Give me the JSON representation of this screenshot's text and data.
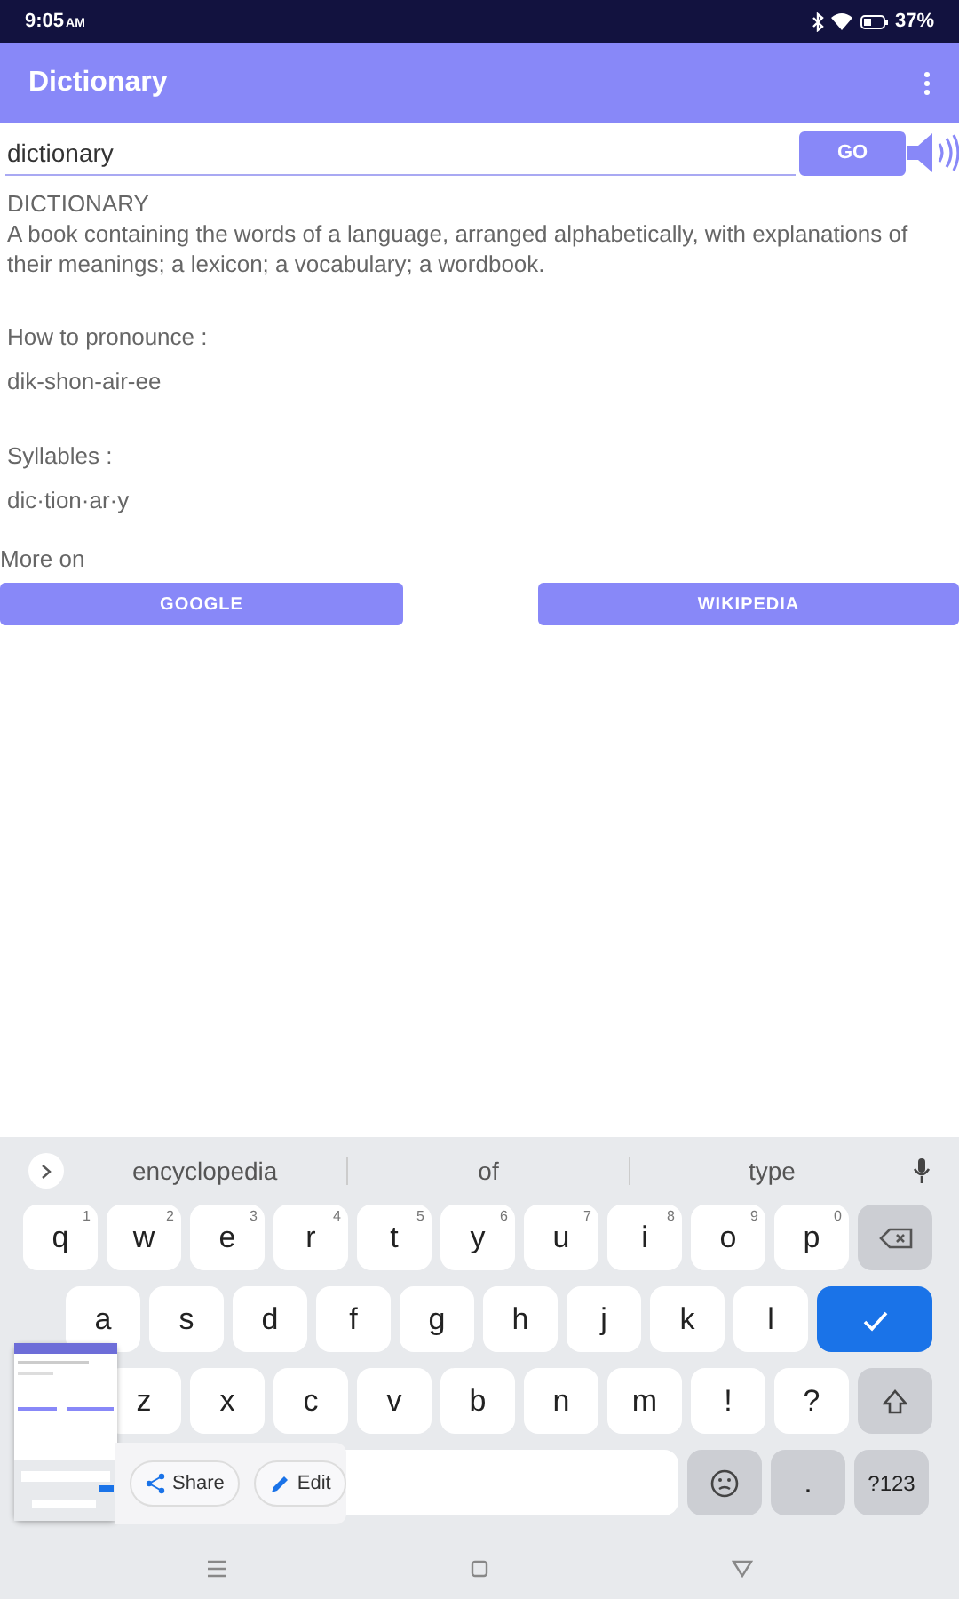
{
  "status_bar": {
    "time": "9:05",
    "meridiem": "AM",
    "battery": "37%"
  },
  "app_bar": {
    "title": "Dictionary"
  },
  "search": {
    "value": "dictionary",
    "button": "GO"
  },
  "entry": {
    "headword": "DICTIONARY",
    "definition": "A book containing the words of a language, arranged alphabetically, with explanations of their meanings; a lexicon; a vocabulary; a wordbook.",
    "pronounce_label": "How to pronounce :",
    "pronunciation": "dik-shon-air-ee",
    "syllables_label": "Syllables :",
    "syllables": "dic·tion·ar·y"
  },
  "more_on": {
    "label": "More on",
    "buttons": [
      "GOOGLE",
      "WIKIPEDIA"
    ]
  },
  "keyboard": {
    "suggestions": [
      "encyclopedia",
      "of",
      "type"
    ],
    "rows": [
      [
        {
          "kind": "char",
          "label": "q",
          "hint": "1"
        },
        {
          "kind": "char",
          "label": "w",
          "hint": "2"
        },
        {
          "kind": "char",
          "label": "e",
          "hint": "3"
        },
        {
          "kind": "char",
          "label": "r",
          "hint": "4"
        },
        {
          "kind": "char",
          "label": "t",
          "hint": "5"
        },
        {
          "kind": "char",
          "label": "y",
          "hint": "6"
        },
        {
          "kind": "char",
          "label": "u",
          "hint": "7"
        },
        {
          "kind": "char",
          "label": "i",
          "hint": "8"
        },
        {
          "kind": "char",
          "label": "o",
          "hint": "9"
        },
        {
          "kind": "char",
          "label": "p",
          "hint": "0"
        },
        {
          "kind": "backspace"
        }
      ],
      [
        {
          "kind": "char",
          "label": "a"
        },
        {
          "kind": "char",
          "label": "s"
        },
        {
          "kind": "char",
          "label": "d"
        },
        {
          "kind": "char",
          "label": "f"
        },
        {
          "kind": "char",
          "label": "g"
        },
        {
          "kind": "char",
          "label": "h"
        },
        {
          "kind": "char",
          "label": "j"
        },
        {
          "kind": "char",
          "label": "k"
        },
        {
          "kind": "char",
          "label": "l"
        },
        {
          "kind": "enter"
        }
      ],
      [
        "",
        {
          "kind": "char",
          "label": "z"
        },
        {
          "kind": "char",
          "label": "x"
        },
        {
          "kind": "char",
          "label": "c"
        },
        {
          "kind": "char",
          "label": "v"
        },
        {
          "kind": "char",
          "label": "b"
        },
        {
          "kind": "char",
          "label": "n"
        },
        {
          "kind": "char",
          "label": "m"
        },
        {
          "kind": "char",
          "label": "!"
        },
        {
          "kind": "char",
          "label": "?"
        },
        {
          "kind": "shift"
        }
      ]
    ],
    "bottom_row": [
      {
        "kind": "space"
      },
      {
        "kind": "emoji"
      },
      {
        "kind": "fn",
        "label": "."
      },
      {
        "kind": "fn",
        "label": "?123"
      }
    ]
  },
  "screenshot_overlay": {
    "actions": [
      {
        "kind": "share",
        "label": "Share"
      },
      {
        "kind": "edit",
        "label": "Edit"
      }
    ]
  }
}
